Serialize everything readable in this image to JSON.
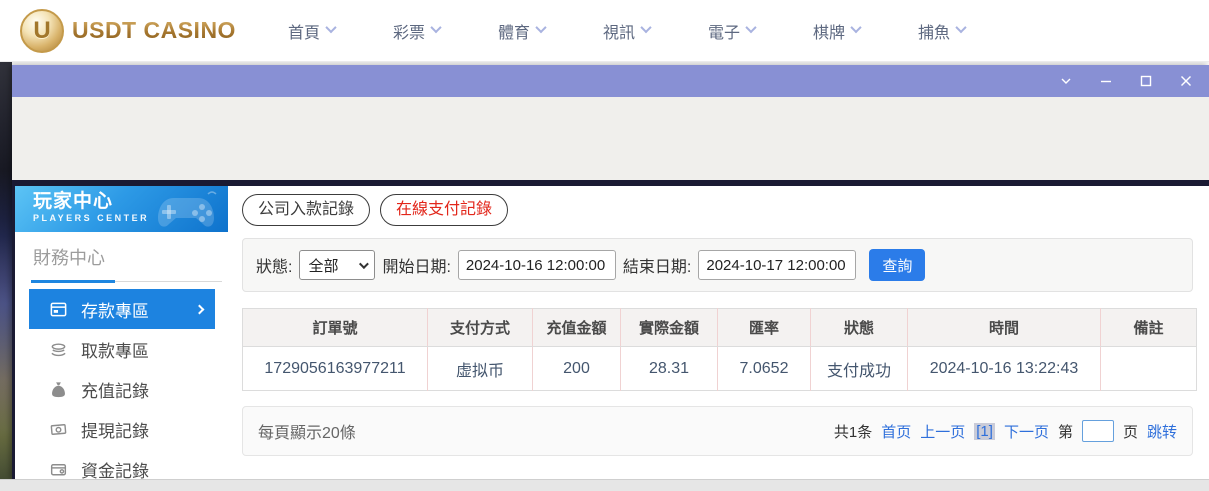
{
  "nav": {
    "logo_letter": "U",
    "logo_text": "USDT CASINO",
    "items": [
      {
        "label": "首頁"
      },
      {
        "label": "彩票"
      },
      {
        "label": "體育"
      },
      {
        "label": "視訊"
      },
      {
        "label": "電子"
      },
      {
        "label": "棋牌"
      },
      {
        "label": "捕魚"
      }
    ]
  },
  "sidebar": {
    "title": "玩家中心",
    "subtitle": "PLAYERS CENTER",
    "section": "財務中心",
    "items": [
      {
        "label": "存款專區",
        "active": true
      },
      {
        "label": "取款專區",
        "active": false
      },
      {
        "label": "充值記錄",
        "active": false
      },
      {
        "label": "提現記錄",
        "active": false
      },
      {
        "label": "資金記錄",
        "active": false
      }
    ]
  },
  "tabs": [
    {
      "label": "公司入款記錄",
      "active": false
    },
    {
      "label": "在線支付記錄",
      "active": true
    }
  ],
  "filters": {
    "status_label": "狀態:",
    "status_value": "全部",
    "start_label": "開始日期:",
    "start_value": "2024-10-16 12:00:00",
    "end_label": "結束日期:",
    "end_value": "2024-10-17 12:00:00",
    "search_button": "查詢"
  },
  "table": {
    "headers": [
      "訂單號",
      "支付方式",
      "充值金額",
      "實際金額",
      "匯率",
      "狀態",
      "時間",
      "備註"
    ],
    "rows": [
      [
        "1729056163977211",
        "虚拟币",
        "200",
        "28.31",
        "7.0652",
        "支付成功",
        "2024-10-16 13:22:43",
        ""
      ]
    ]
  },
  "pagination": {
    "page_size_text": "每頁顯示20條",
    "total_text": "共1条",
    "first": "首页",
    "prev": "上一页",
    "current": "[1]",
    "next": "下一页",
    "jump_prefix": "第",
    "jump_suffix": "页",
    "jump_action": "跳转",
    "jump_value": ""
  },
  "colors": {
    "brand_gold": "#a6772f",
    "titlebar_purple": "#8890d4",
    "sidebar_header_blue": "#1e86e0",
    "active_menu_blue": "#1d83e0",
    "accent_blue_button": "#2b7ce9",
    "tab_active_red": "#e2261a",
    "link_blue": "#2e6fdb",
    "table_divider_pink": "#f0d2d2"
  }
}
